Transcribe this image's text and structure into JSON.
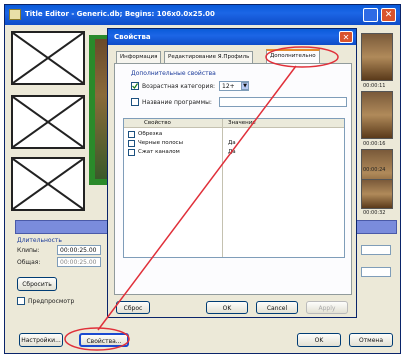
{
  "main_window": {
    "title": "Title Editor - Generic.db; Begins: 106x0.0x25.00",
    "close_glyph": "✕",
    "right_frames": [
      {
        "label": "00:00:11"
      },
      {
        "label": "00:00:16"
      },
      {
        "label": "00:00:24"
      },
      {
        "label": "00:00:32"
      }
    ],
    "duration_header": "Длительность",
    "clip_label": "Клипы:",
    "clip_value": "00:00:25.00",
    "total_label": "Общая:",
    "total_value": "00:00:25.00",
    "reset_button": "Сбросить",
    "preview_checkbox_label": "Предпросмотр",
    "settings_button": "Настройки...",
    "properties_button": "Свойства...",
    "ok_button": "OK",
    "cancel_button": "Отмена"
  },
  "dialog": {
    "title": "Свойства",
    "close_glyph": "✕",
    "tabs": [
      {
        "label": "Информация"
      },
      {
        "label": "Редактирование Я.Профиль"
      },
      {
        "label": "Дополнительно"
      }
    ],
    "section_title": "Дополнительные свойства",
    "age_checkbox_label": "Возрастная категория:",
    "age_value": "12+",
    "program_checkbox_label": "Название программы:",
    "program_value": "",
    "grid": {
      "columns": [
        "Свойство",
        "Значение"
      ],
      "rows": [
        {
          "property": "Обрезка",
          "value": ""
        },
        {
          "property": "Черные полосы",
          "value": "Да"
        },
        {
          "property": "Сжат каналом",
          "value": "Да"
        }
      ]
    },
    "buttons": {
      "left": "Сброс",
      "ok": "OK",
      "cancel": "Cancel",
      "apply": "Apply"
    }
  },
  "annotation": {
    "color": "#e0303a"
  }
}
